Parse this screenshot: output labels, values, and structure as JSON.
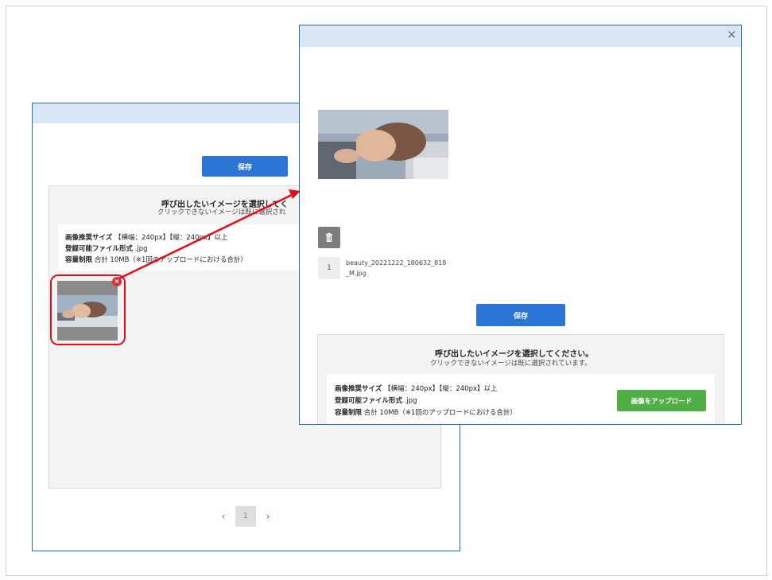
{
  "back_dialog": {
    "save_label": "保存",
    "panel_title": "呼び出したいイメージを選択してく",
    "panel_subtitle": "クリックできないイメージは既に選択され",
    "info": {
      "size_label": "画像推奨サイズ",
      "size_value": "【横幅：240px】【縦：240px】以上",
      "format_label": "登録可能ファイル形式",
      "format_value": ".jpg",
      "capacity_label": "容量制限",
      "capacity_value": "合計 10MB（※1回のアップロードにおける合計）"
    },
    "remove_badge": "×",
    "pagination": {
      "prev": "‹",
      "current": "1",
      "next": "›"
    }
  },
  "front_dialog": {
    "close_label": "×",
    "file_index": "1",
    "file_name": "beauty_20221222_180632_818_M.jpg",
    "save_label": "保存",
    "panel_title": "呼び出したいイメージを選択してください。",
    "panel_subtitle": "クリックできないイメージは既に選択されています。",
    "info": {
      "size_label": "画像推奨サイズ",
      "size_value": "【横幅：240px】【縦：240px】以上",
      "format_label": "登録可能ファイル形式",
      "format_value": ".jpg",
      "capacity_label": "容量制限",
      "capacity_value": "合計 10MB（※1回のアップロードにおける合計）"
    },
    "upload_label": "画像をアップロード"
  },
  "icons": {
    "trash": "trash-icon",
    "close": "close-icon",
    "remove": "remove-icon",
    "annotation_arrow": "arrow-icon"
  },
  "colors": {
    "accent_blue": "#2a75d6",
    "header_blue": "#d8e6f6",
    "upload_green": "#4fae45",
    "highlight_red": "#e0101a"
  }
}
